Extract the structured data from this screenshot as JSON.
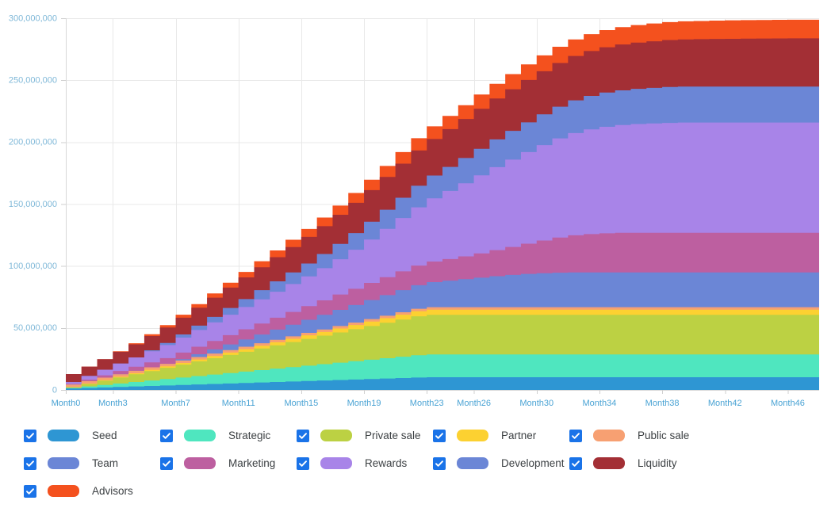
{
  "chart_data": {
    "type": "area",
    "title": "",
    "subtitle": "",
    "xlabel": "",
    "ylabel": "",
    "stacked": true,
    "grid": true,
    "legend_position": "bottom",
    "ylim": [
      0,
      300000000
    ],
    "y_ticks": [
      0,
      50000000,
      100000000,
      150000000,
      200000000,
      250000000,
      300000000
    ],
    "y_tick_labels": [
      "0",
      "50,000,000",
      "100,000,000",
      "150,000,000",
      "200,000,000",
      "250,000,000",
      "300,000,000"
    ],
    "x_tick_labels": [
      "Month0",
      "Month3",
      "Month7",
      "Month11",
      "Month15",
      "Month19",
      "Month23",
      "Month26",
      "Month30",
      "Month34",
      "Month38",
      "Month42",
      "Month46"
    ],
    "x_tick_indices": [
      0,
      3,
      7,
      11,
      15,
      19,
      23,
      26,
      30,
      34,
      38,
      42,
      46
    ],
    "x": [
      0,
      1,
      2,
      3,
      4,
      5,
      6,
      7,
      8,
      9,
      10,
      11,
      12,
      13,
      14,
      15,
      16,
      17,
      18,
      19,
      20,
      21,
      22,
      23,
      24,
      25,
      26,
      27,
      28,
      29,
      30,
      31,
      32,
      33,
      34,
      35,
      36,
      37,
      38,
      39,
      40,
      41,
      42,
      43,
      44,
      45,
      46,
      47,
      48
    ],
    "total_final": 298000000,
    "series": [
      {
        "name": "Seed",
        "color": "#2e96d3",
        "values": [
          1200000,
          1600000,
          2000000,
          2400000,
          2800000,
          3200000,
          3600000,
          4000000,
          4400000,
          4800000,
          5200000,
          5600000,
          6000000,
          6400000,
          6800000,
          7200000,
          7600000,
          8000000,
          8400000,
          8800000,
          9200000,
          9600000,
          10000000,
          10200000,
          10200000,
          10200000,
          10200000,
          10200000,
          10200000,
          10200000,
          10200000,
          10200000,
          10200000,
          10200000,
          10200000,
          10200000,
          10200000,
          10200000,
          10200000,
          10200000,
          10200000,
          10200000,
          10200000,
          10200000,
          10200000,
          10200000,
          10200000,
          10200000,
          10200000
        ]
      },
      {
        "name": "Strategic",
        "color": "#4fe6bf",
        "values": [
          400000,
          1200000,
          2000000,
          2800000,
          3600000,
          4400000,
          5200000,
          6000000,
          6800000,
          7600000,
          8400000,
          9200000,
          10000000,
          10800000,
          11600000,
          12400000,
          13200000,
          14000000,
          14800000,
          15600000,
          16400000,
          17200000,
          18000000,
          18400000,
          18400000,
          18400000,
          18400000,
          18400000,
          18400000,
          18400000,
          18400000,
          18400000,
          18400000,
          18400000,
          18400000,
          18400000,
          18400000,
          18400000,
          18400000,
          18400000,
          18400000,
          18400000,
          18400000,
          18400000,
          18400000,
          18400000,
          18400000,
          18400000,
          18400000
        ]
      },
      {
        "name": "Private sale",
        "color": "#bcd143",
        "values": [
          600000,
          2000000,
          3400000,
          4800000,
          6200000,
          7600000,
          9000000,
          10400000,
          11800000,
          13200000,
          14600000,
          16000000,
          17400000,
          18800000,
          20200000,
          21600000,
          23000000,
          24400000,
          25800000,
          27200000,
          28600000,
          30000000,
          31400000,
          32000000,
          32000000,
          32000000,
          32000000,
          32000000,
          32000000,
          32000000,
          32000000,
          32000000,
          32000000,
          32000000,
          32000000,
          32000000,
          32000000,
          32000000,
          32000000,
          32000000,
          32000000,
          32000000,
          32000000,
          32000000,
          32000000,
          32000000,
          32000000,
          32000000,
          32000000
        ]
      },
      {
        "name": "Partner",
        "color": "#fcd131",
        "values": [
          120000,
          300000,
          480000,
          660000,
          840000,
          1020000,
          1200000,
          1380000,
          1560000,
          1740000,
          1920000,
          2100000,
          2280000,
          2460000,
          2640000,
          2820000,
          3000000,
          3180000,
          3360000,
          3540000,
          3720000,
          3900000,
          4080000,
          4200000,
          4200000,
          4200000,
          4200000,
          4200000,
          4200000,
          4200000,
          4200000,
          4200000,
          4200000,
          4200000,
          4200000,
          4200000,
          4200000,
          4200000,
          4200000,
          4200000,
          4200000,
          4200000,
          4200000,
          4200000,
          4200000,
          4200000,
          4200000,
          4200000,
          4200000
        ]
      },
      {
        "name": "Public sale",
        "color": "#f7a072",
        "values": [
          2000000,
          2000000,
          2000000,
          2000000,
          2000000,
          2000000,
          2000000,
          2000000,
          2000000,
          2000000,
          2000000,
          2000000,
          2000000,
          2000000,
          2000000,
          2000000,
          2000000,
          2000000,
          2000000,
          2000000,
          2000000,
          2000000,
          2000000,
          2000000,
          2000000,
          2000000,
          2000000,
          2000000,
          2000000,
          2000000,
          2000000,
          2000000,
          2000000,
          2000000,
          2000000,
          2000000,
          2000000,
          2000000,
          2000000,
          2000000,
          2000000,
          2000000,
          2000000,
          2000000,
          2000000,
          2000000,
          2000000,
          2000000,
          2000000
        ]
      },
      {
        "name": "Team",
        "color": "#6b86d6",
        "values": [
          0,
          0,
          0,
          0,
          0,
          0,
          0,
          1000000,
          2200000,
          3400000,
          4600000,
          5800000,
          7000000,
          8200000,
          9400000,
          10600000,
          11800000,
          13000000,
          14200000,
          15400000,
          16600000,
          17800000,
          19000000,
          20200000,
          21400000,
          22600000,
          23800000,
          25000000,
          26000000,
          26800000,
          27400000,
          27800000,
          28000000,
          28000000,
          28000000,
          28000000,
          28000000,
          28000000,
          28000000,
          28000000,
          28000000,
          28000000,
          28000000,
          28000000,
          28000000,
          28000000,
          28000000,
          28000000,
          28000000
        ]
      },
      {
        "name": "Marketing",
        "color": "#bd5fa0",
        "values": [
          500000,
          1200000,
          1900000,
          2600000,
          3300000,
          4000000,
          4700000,
          5400000,
          6100000,
          6800000,
          7500000,
          8200000,
          8900000,
          9600000,
          10300000,
          11000000,
          11700000,
          12400000,
          13100000,
          13800000,
          14500000,
          15200000,
          15900000,
          16600000,
          17400000,
          18400000,
          19600000,
          21000000,
          22600000,
          24400000,
          26400000,
          28400000,
          30000000,
          31000000,
          31600000,
          32000000,
          32000000,
          32000000,
          32000000,
          32000000,
          32000000,
          32000000,
          32000000,
          32000000,
          32000000,
          32000000,
          32000000,
          32000000,
          32000000
        ]
      },
      {
        "name": "Rewards",
        "color": "#a884e8",
        "values": [
          1500000,
          3000000,
          4500000,
          6000000,
          7500000,
          9000000,
          10500000,
          12000000,
          13500000,
          15000000,
          16500000,
          18000000,
          19500000,
          21000000,
          22500000,
          24000000,
          26000000,
          28500000,
          31500000,
          35000000,
          39000000,
          43000000,
          47000000,
          51000000,
          55000000,
          59000000,
          63000000,
          67000000,
          70500000,
          74000000,
          77000000,
          80000000,
          82500000,
          84500000,
          86000000,
          87000000,
          87800000,
          88300000,
          88700000,
          89000000,
          89000000,
          89000000,
          89000000,
          89000000,
          89000000,
          89000000,
          89000000,
          89000000,
          89000000
        ]
      },
      {
        "name": "Development",
        "color": "#6b86d6",
        "values": [
          0,
          0,
          0,
          0,
          0,
          800000,
          1700000,
          2600000,
          3500000,
          4400000,
          5400000,
          6400000,
          7400000,
          8400000,
          9400000,
          10400000,
          11400000,
          12400000,
          13400000,
          14400000,
          15400000,
          16400000,
          17400000,
          18400000,
          19400000,
          20400000,
          21400000,
          22400000,
          23200000,
          24000000,
          24800000,
          25600000,
          26400000,
          27000000,
          27600000,
          28000000,
          28400000,
          28700000,
          29000000,
          29000000,
          29000000,
          29000000,
          29000000,
          29000000,
          29000000,
          29000000,
          29000000,
          29000000,
          29000000
        ]
      },
      {
        "name": "Liquidity",
        "color": "#a32f35",
        "values": [
          6500000,
          7500000,
          8500000,
          9500000,
          10500000,
          11500000,
          12500000,
          13500000,
          14500000,
          15500000,
          16500000,
          17500000,
          18500000,
          19500000,
          20500000,
          21500000,
          22500000,
          23500000,
          24500000,
          25500000,
          26500000,
          27500000,
          28500000,
          29500000,
          30500000,
          31500000,
          32300000,
          33000000,
          33600000,
          34200000,
          34800000,
          35300000,
          35800000,
          36200000,
          36600000,
          37000000,
          37300000,
          37600000,
          37900000,
          38100000,
          38300000,
          38500000,
          38600000,
          38700000,
          38800000,
          38900000,
          39000000,
          39000000,
          39000000
        ]
      },
      {
        "name": "Advisors",
        "color": "#f4511e",
        "values": [
          0,
          0,
          0,
          400000,
          900000,
          1400000,
          1900000,
          2400000,
          2900000,
          3400000,
          3900000,
          4400000,
          4900000,
          5400000,
          5900000,
          6400000,
          6900000,
          7400000,
          7900000,
          8400000,
          8900000,
          9400000,
          9900000,
          10300000,
          10700000,
          11100000,
          11500000,
          11900000,
          12200000,
          12500000,
          12800000,
          13100000,
          13400000,
          13600000,
          13800000,
          14000000,
          14200000,
          14400000,
          14500000,
          14600000,
          14700000,
          14800000,
          14900000,
          15000000,
          15000000,
          15000000,
          15000000,
          15000000,
          15000000
        ]
      }
    ]
  },
  "legend": {
    "rows": [
      [
        {
          "label": "Seed",
          "color": "#2e96d3",
          "checked": true
        },
        {
          "label": "Strategic",
          "color": "#4fe6bf",
          "checked": true
        },
        {
          "label": "Private sale",
          "color": "#bcd143",
          "checked": true
        },
        {
          "label": "Partner",
          "color": "#fcd131",
          "checked": true
        },
        {
          "label": "Public sale",
          "color": "#f7a072",
          "checked": true
        }
      ],
      [
        {
          "label": "Team",
          "color": "#6b86d6",
          "checked": true
        },
        {
          "label": "Marketing",
          "color": "#bd5fa0",
          "checked": true
        },
        {
          "label": "Rewards",
          "color": "#a884e8",
          "checked": true
        },
        {
          "label": "Development",
          "color": "#6b86d6",
          "checked": true
        },
        {
          "label": "Liquidity",
          "color": "#a32f35",
          "checked": true
        }
      ],
      [
        {
          "label": "Advisors",
          "color": "#f4511e",
          "checked": true
        }
      ]
    ]
  },
  "theme": {
    "axis_label_color": "#4aa3d4",
    "grid_color": "#e8e8e8",
    "checkbox_color": "#1a73e8",
    "legend_text_color": "#3c4043",
    "background": "#ffffff"
  }
}
